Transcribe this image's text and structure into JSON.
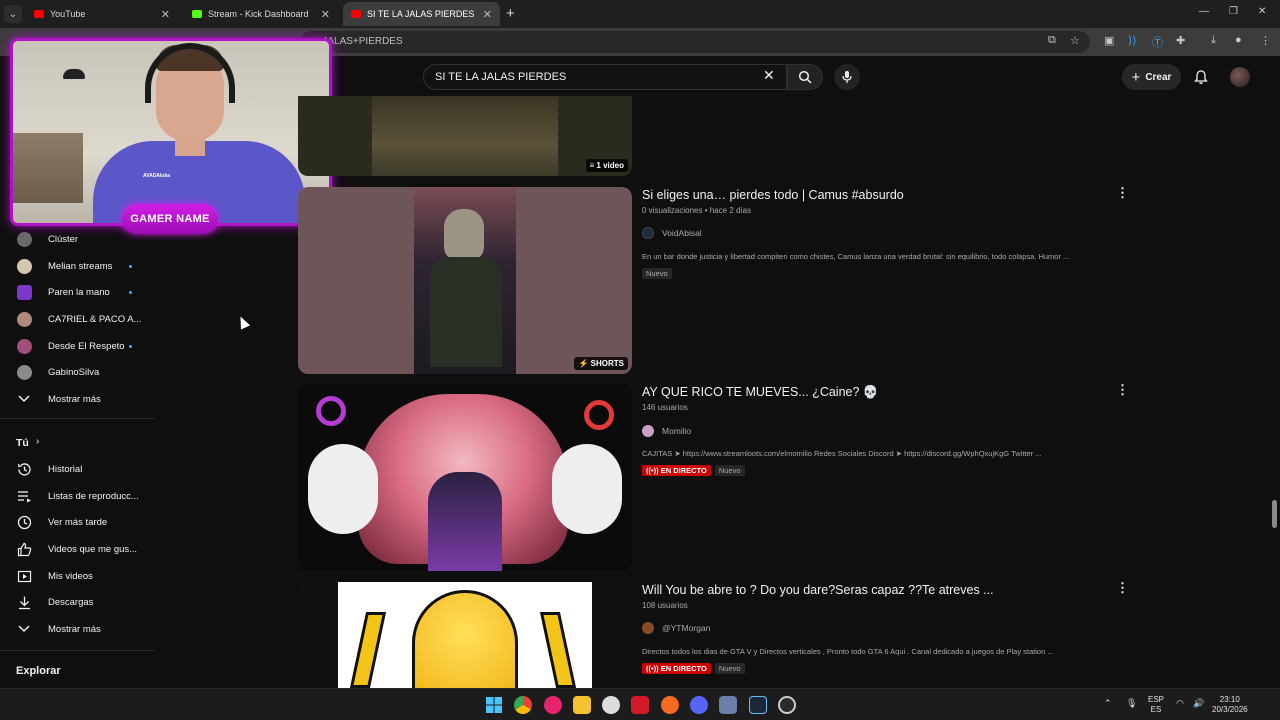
{
  "browser": {
    "tabs": [
      {
        "title": "YouTube",
        "favicon_color": "#ff0000"
      },
      {
        "title": "Stream - Kick Dashboard",
        "favicon_color": "#53fc18"
      },
      {
        "title": "SI TE LA JALAS PIERDES - YouTu...",
        "favicon_color": "#ff0000"
      }
    ],
    "url_text": "...JALAS+PIERDES"
  },
  "header": {
    "search_value": "SI TE LA JALAS PIERDES",
    "create_label": "Crear"
  },
  "overlay": {
    "gamer_name": "GAMER NAME",
    "shirt_logo": "AVADAluka"
  },
  "sidebar": {
    "subscriptions": [
      {
        "label": "Clúster",
        "live": false,
        "color": "#6a6a6a"
      },
      {
        "label": "Melian streams",
        "live": true,
        "color": "#d8c7b0"
      },
      {
        "label": "Paren la mano",
        "live": true,
        "color": "#7a37c8"
      },
      {
        "label": "CA7RIEL & PACO A...",
        "live": false,
        "color": "#b08a7a"
      },
      {
        "label": "Desde El Respeto",
        "live": true,
        "color": "#a0507a"
      },
      {
        "label": "GabinoSilva",
        "live": false,
        "color": "#8a8a8a"
      }
    ],
    "show_more_1": "Mostrar más",
    "you_heading": "Tú",
    "you_items": [
      {
        "label": "Historial",
        "icon": "history-icon"
      },
      {
        "label": "Listas de reproducc...",
        "icon": "playlists-icon"
      },
      {
        "label": "Ver más tarde",
        "icon": "watch-later-icon"
      },
      {
        "label": "Videos que me gus...",
        "icon": "like-icon"
      },
      {
        "label": "Mis videos",
        "icon": "my-videos-icon"
      },
      {
        "label": "Descargas",
        "icon": "download-icon"
      }
    ],
    "show_more_2": "Mostrar más",
    "explore_heading": "Explorar"
  },
  "results": [
    {
      "badge": "1 video"
    },
    {
      "title": "Si eliges una… pierdes todo | Camus #absurdo",
      "meta": "0 visualizaciones • hace 2 días",
      "channel": "VoidAbisal",
      "description": "En un bar donde justicia y libertad compiten como chistes, Camus lanza una verdad brutal: sin equilibrio, todo colapsa. Humor ...",
      "badges": [
        "Nuevo"
      ],
      "thumb_badge": "SHORTS"
    },
    {
      "title": "AY QUE RICO TE MUEVES... ¿Caine? 💀",
      "meta": "146 usuarios",
      "channel": "Momilio",
      "description": "CAJITAS ➤ https://www.streamloots.com/elmomilio Redes Sociales Discord ➤ https://discord.gg/WphQxujKgG Twitter ...",
      "live_label": "EN DIRECTO",
      "new_label": "Nuevo"
    },
    {
      "title": "Will You be abre to ? Do you dare?Seras capaz ??Te atreves ...",
      "meta": "108 usuarios",
      "channel": "@YTMorgan",
      "description": "Directos todos los dias de GTA V y Directos verticales , Pronto todo GTA 6 Aqui . Canal dedicado a juegos de Play station ...",
      "live_label": "EN DIRECTO",
      "new_label": "Nuevo"
    }
  ],
  "taskbar": {
    "lang_top": "ESP",
    "lang_bottom": "ES",
    "time": "23:10",
    "date": "20/3/2026"
  }
}
